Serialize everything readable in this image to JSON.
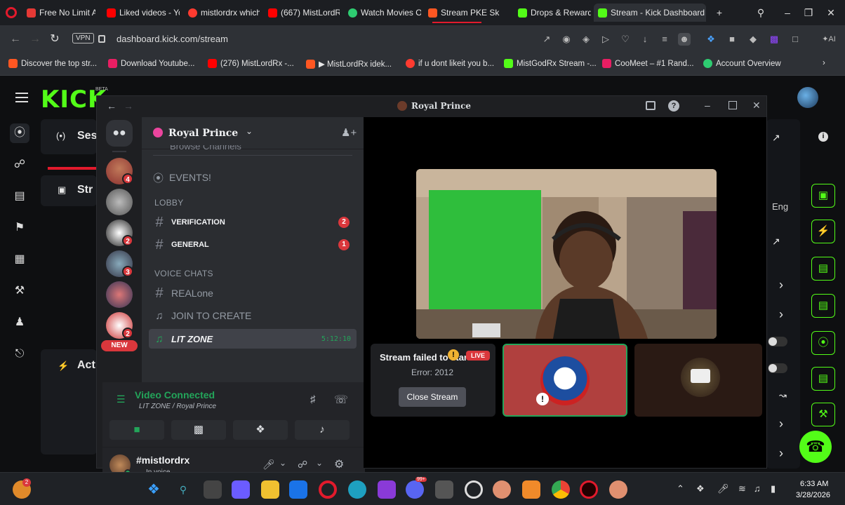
{
  "browser": {
    "tabs": [
      {
        "label": "Free No Limit AI",
        "color": "#e53935"
      },
      {
        "label": "Liked videos - Yo",
        "color": "#ff0000"
      },
      {
        "label": "mistlordrx which",
        "color": "#ff3b30"
      },
      {
        "label": "(667) MistLordR",
        "color": "#ff0000"
      },
      {
        "label": "Watch Movies Or",
        "color": "#2ecc71"
      },
      {
        "label": "Stream PKE Sk",
        "color": "#ff5722"
      },
      {
        "label": "Drops & Rewards",
        "color": "#53fc18"
      },
      {
        "label": "Stream - Kick Dashboard",
        "color": "#53fc18"
      }
    ],
    "vpn_label": "VPN",
    "url": "dashboard.kick.com/stream",
    "bookmarks": [
      {
        "label": "Discover the top str...",
        "color": "#ff5722"
      },
      {
        "label": "Download Youtube...",
        "color": "#e91e63"
      },
      {
        "label": "(276) MistLordRx -...",
        "color": "#ff0000"
      },
      {
        "label": "▶ MistLordRx idek...",
        "color": "#ff5722"
      },
      {
        "label": "if u dont likeit you b...",
        "color": "#ff3b30"
      },
      {
        "label": "MistGodRx Stream -...",
        "color": "#53fc18"
      },
      {
        "label": "CooMeet – #1 Rand...",
        "color": "#e91e63"
      },
      {
        "label": "Account Overview",
        "color": "#2ecc71"
      }
    ]
  },
  "kick": {
    "logo": "KICK",
    "beta": "BETA",
    "card_session_label": "Ses",
    "card_stream_label": "Str",
    "card_activity_label": "Act",
    "lang_label": "Eng"
  },
  "discord": {
    "title": "Royal Prince",
    "server_name": "Royal Prince",
    "browse_channels": "Browse Channels",
    "events_label": "EVENTS!",
    "cat_lobby": "LOBBY",
    "verification_label": "VERIFICATION",
    "verification_count": "2",
    "general_label": "GENERAL",
    "general_count": "1",
    "cat_voice": "VOICE CHATS",
    "realone_label": "REALone",
    "join_label": "JOIN TO CREATE",
    "litzone_label": "LIT ZONE",
    "litzone_time": "5:12:10",
    "new_label": "NEW",
    "server_badges": [
      "4",
      "2",
      "3",
      "2"
    ],
    "voice_status": "Video Connected",
    "voice_location": "LIT ZONE / Royal Prince",
    "username": "#mistlordrx",
    "user_status": "In voice",
    "stream_failed_title": "Stream failed to start",
    "live_label": "LIVE",
    "stream_error": "Error: 2012",
    "close_stream_label": "Close Stream"
  },
  "taskbar": {
    "time": "6:33 AM",
    "date": "3/28/2026",
    "discord_badge": "99+",
    "notification_count": "2"
  }
}
